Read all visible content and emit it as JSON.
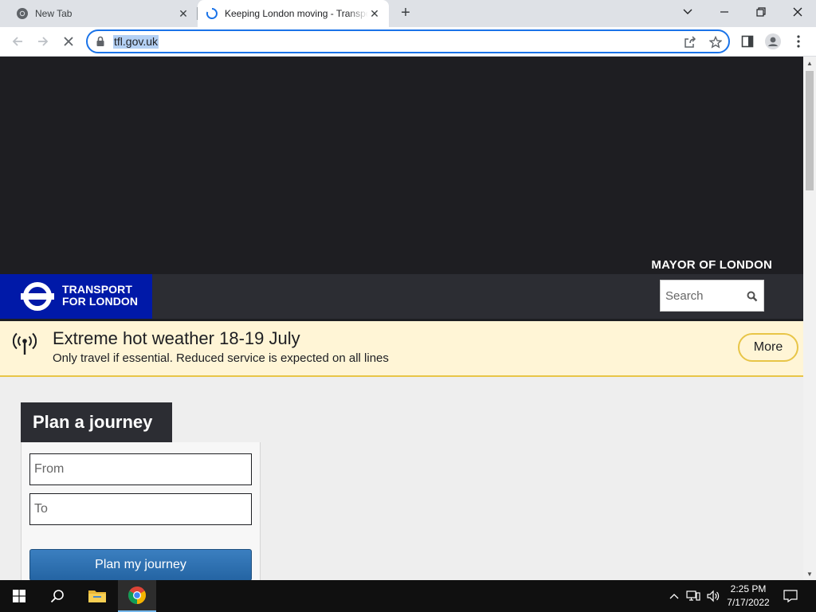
{
  "browser": {
    "tabs": [
      {
        "title": "New Tab",
        "favicon": "chrome-icon",
        "active": false
      },
      {
        "title": "Keeping London moving - Transport for London",
        "favicon": "loading-spinner-icon",
        "active": true
      }
    ],
    "address": {
      "url": "tfl.gov.uk",
      "secure": true
    },
    "accent_color": "#1a73e8"
  },
  "page": {
    "mayor_label": "MAYOR OF LONDON",
    "logo": {
      "line1": "TRANSPORT",
      "line2": "FOR LONDON",
      "color": "#0019a8"
    },
    "search": {
      "placeholder": "Search"
    },
    "alert": {
      "title": "Extreme hot weather 18-19 July",
      "text": "Only travel if essential. Reduced service is expected on all lines",
      "button": "More",
      "accent_color": "#e8c547"
    },
    "planner": {
      "heading": "Plan a journey",
      "from_placeholder": "From",
      "to_placeholder": "To",
      "submit": "Plan my journey"
    }
  },
  "taskbar": {
    "time": "2:25 PM",
    "date": "7/17/2022",
    "pinned": [
      "windows-start-icon",
      "search-icon",
      "file-explorer-icon",
      "chrome-icon"
    ]
  }
}
